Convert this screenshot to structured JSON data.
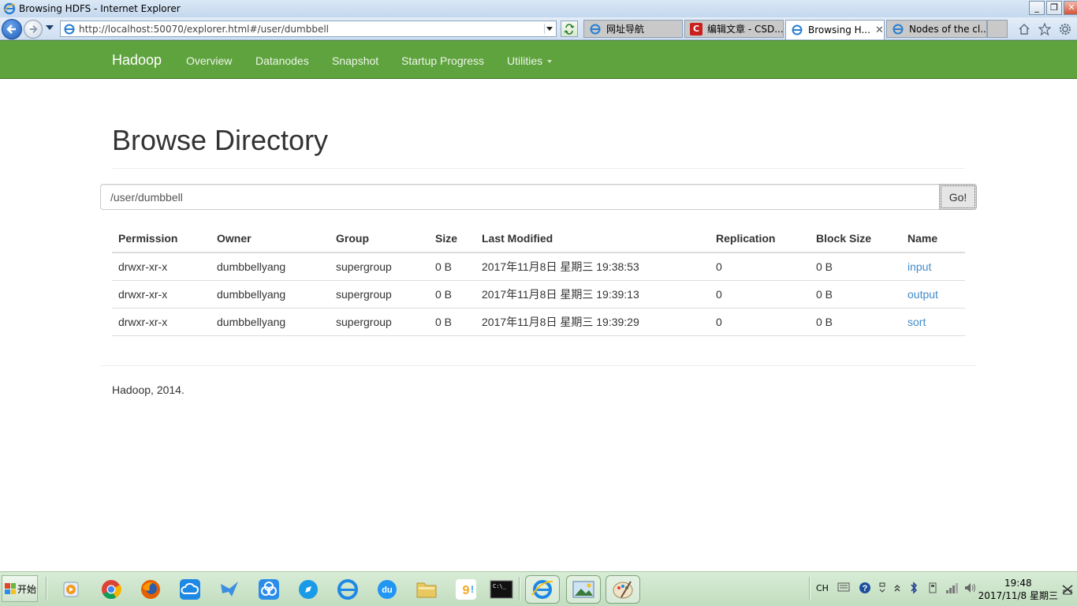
{
  "window": {
    "title": "Browsing HDFS - Internet Explorer",
    "minimize": "_",
    "restore": "❐",
    "close": "✕"
  },
  "browser": {
    "url": "http://localhost:50070/explorer.html#/user/dumbbell",
    "tabs": [
      {
        "label": "网址导航",
        "active": false
      },
      {
        "label": "编辑文章 - CSD...",
        "active": false
      },
      {
        "label": "Browsing H...",
        "active": true,
        "close": "✕"
      },
      {
        "label": "Nodes of the cl...",
        "active": false
      }
    ]
  },
  "navbar": {
    "brand": "Hadoop",
    "items": [
      "Overview",
      "Datanodes",
      "Snapshot",
      "Startup Progress",
      "Utilities"
    ]
  },
  "page": {
    "title": "Browse Directory",
    "path_value": "/user/dumbbell",
    "go_label": "Go!"
  },
  "table": {
    "headers": [
      "Permission",
      "Owner",
      "Group",
      "Size",
      "Last Modified",
      "Replication",
      "Block Size",
      "Name"
    ],
    "rows": [
      [
        "drwxr-xr-x",
        "dumbbellyang",
        "supergroup",
        "0 B",
        "2017年11月8日 星期三 19:38:53",
        "0",
        "0 B",
        "input"
      ],
      [
        "drwxr-xr-x",
        "dumbbellyang",
        "supergroup",
        "0 B",
        "2017年11月8日 星期三 19:39:13",
        "0",
        "0 B",
        "output"
      ],
      [
        "drwxr-xr-x",
        "dumbbellyang",
        "supergroup",
        "0 B",
        "2017年11月8日 星期三 19:39:29",
        "0",
        "0 B",
        "sort"
      ]
    ]
  },
  "footer": {
    "text": "Hadoop, 2014."
  },
  "taskbar": {
    "start_label": "开始",
    "lang": "CH",
    "time": "19:48",
    "date": "2017/11/8 星期三"
  },
  "colors": {
    "navbar_green": "#5fa33e",
    "link_blue": "#428bca"
  }
}
